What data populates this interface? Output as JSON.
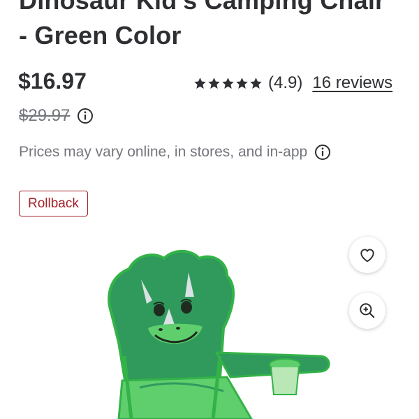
{
  "product": {
    "title_line1": "Dinosaur Kid's Camping Chair",
    "title_line2": "- Green Color",
    "price": "$16.97",
    "was_price": "$29.97",
    "rating_value": "(4.9)",
    "stars": 5,
    "reviews_link": "16 reviews",
    "disclaimer": "Prices may vary online, in stores, and in-app",
    "badge": "Rollback"
  },
  "icons": {
    "favorite": "heart-icon",
    "zoom": "zoom-in-icon",
    "info": "info-icon",
    "star": "star-icon"
  },
  "colors": {
    "text": "#2e2f32",
    "muted": "#74767c",
    "rollback": "#a32129",
    "chair_green": "#2f9a5c",
    "chair_light_green": "#5fcf6e"
  }
}
